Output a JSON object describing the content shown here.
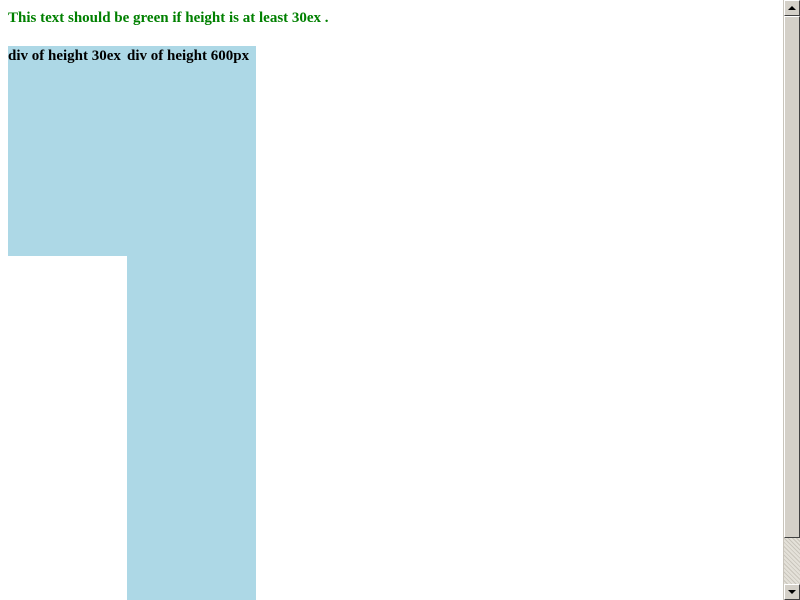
{
  "page": {
    "result_text": "This text should be green if height is at least 30ex .",
    "result_color": "#008000",
    "box_color": "#add8e6"
  },
  "boxes": [
    {
      "label": "div of height 30ex"
    },
    {
      "label": "div of height 600px"
    }
  ],
  "scrollbar": {
    "up_icon": "arrow-up-icon",
    "down_icon": "arrow-down-icon"
  }
}
